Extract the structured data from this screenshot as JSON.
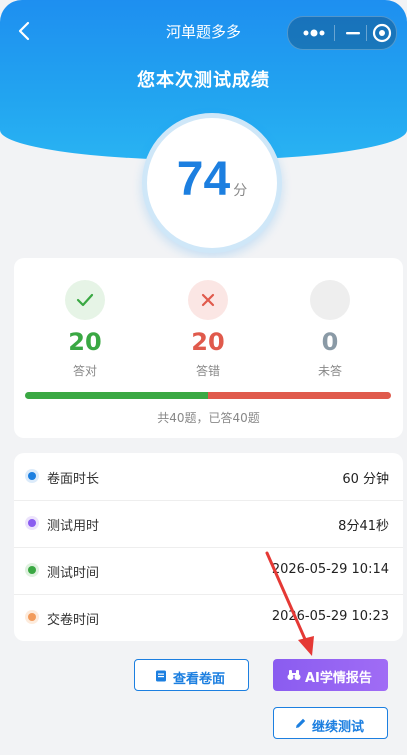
{
  "nav": {
    "title": "河单题多多"
  },
  "page_title": "您本次测试成绩",
  "score": {
    "value": "74",
    "unit": "分"
  },
  "stats": {
    "correct": {
      "count": "20",
      "label": "答对"
    },
    "wrong": {
      "count": "20",
      "label": "答错"
    },
    "unanswered": {
      "count": "0",
      "label": "未答"
    },
    "progress": {
      "correct_fraction": 0.5,
      "wrong_fraction": 0.5
    },
    "summary": "共40题，已答40题"
  },
  "info": [
    {
      "label": "卷面时长",
      "value": "60 分钟"
    },
    {
      "label": "测试用时",
      "value": "8分41秒"
    },
    {
      "label": "测试时间",
      "value": "2026-05-29 10:14"
    },
    {
      "label": "交卷时间",
      "value": "2026-05-29 10:23"
    }
  ],
  "buttons": {
    "view_paper": "查看卷面",
    "ai_report": "AI学情报告",
    "continue_test": "继续测试"
  },
  "colors": {
    "primary": "#1c7fe0",
    "correct": "#3aa843",
    "wrong": "#e05a4c",
    "unanswered": "#8a9aa6",
    "ai": "#8a5cf0",
    "dot_duration": "#1c7fe0",
    "dot_used": "#8a5cf0",
    "dot_test_time": "#3aa843",
    "dot_submit_time": "#f29b5b"
  },
  "icons": {
    "back": "chevron-left-icon",
    "more": "more-dots-icon",
    "minimize": "minimize-icon",
    "close": "target-circle-icon",
    "correct": "check-icon",
    "wrong": "cross-icon",
    "paper": "document-icon",
    "ai": "binoculars-icon",
    "continue": "pencil-icon",
    "annotation": "red-arrow-icon"
  }
}
